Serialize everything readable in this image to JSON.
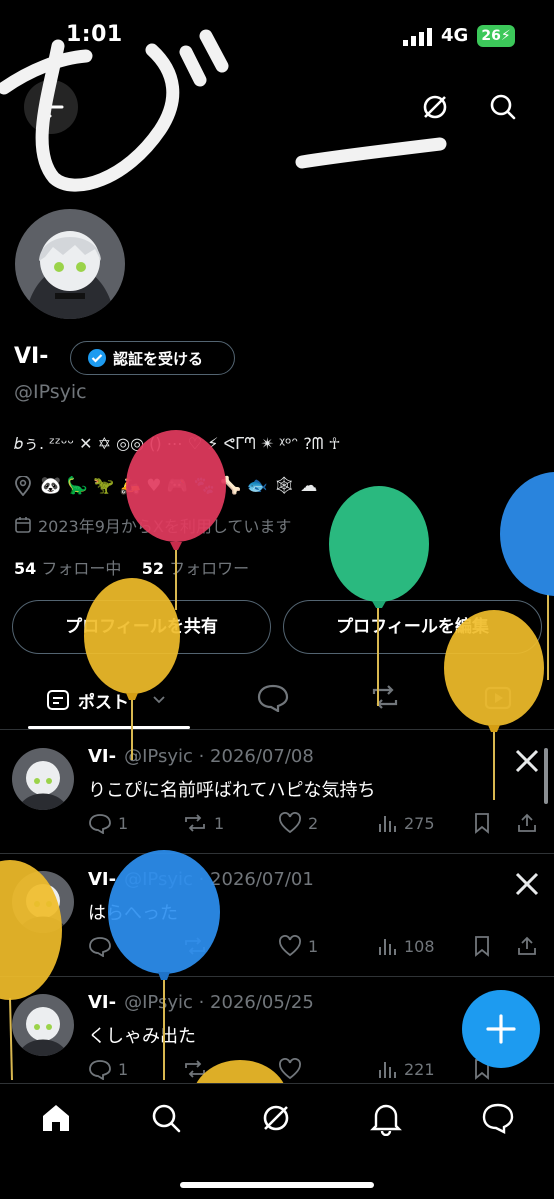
{
  "status_bar": {
    "time": "1:01",
    "network": "4G",
    "battery": "26"
  },
  "profile": {
    "display_name": "VI-",
    "verify_label": "認証を受ける",
    "handle": "@IPsyic",
    "bio": "𝑏ぅ. ᶻᶻᵕᵕ ✕ ✡ ◎◎ () ⋯ ♡ ⚡ ᕙᒥᘉ ✴ ᵡᵒᵔ ?ᗰ ☥",
    "location_emojis": "🐼 🦕 🦖 🛵 ♥ 🎮 🐾 🦴 🐟 🕸 ☁",
    "joined": "2023年9月からXを利用しています",
    "following_count": "54",
    "following_label": "フォロー中",
    "followers_count": "52",
    "followers_label": "フォロワー",
    "share_label": "プロフィールを共有",
    "edit_label": "プロフィールを編集"
  },
  "tabs": {
    "posts_label": "ポスト"
  },
  "posts": [
    {
      "name": "VI-",
      "handle_date": "@IPsyic · 2026/07/08",
      "text": "りこぴに名前呼ばれてハピな気持ち",
      "replies": "1",
      "reposts": "1",
      "likes": "2",
      "views": "275"
    },
    {
      "name": "VI-",
      "handle_date": "@IPsyic · 2026/07/01",
      "text": "はらへった",
      "replies": "",
      "reposts": "",
      "likes": "1",
      "views": "108"
    },
    {
      "name": "VI-",
      "handle_date": "@IPsyic · 2026/05/25",
      "text": "くしゃみ出た",
      "replies": "1",
      "reposts": "",
      "likes": "",
      "views": "221"
    }
  ],
  "overlay": {
    "handwriting": "びー"
  },
  "colors": {
    "accent": "#1d9bf0",
    "muted": "#71767b",
    "balloon_red": "#e33b5e",
    "balloon_green": "#2ec98a",
    "balloon_yellow": "#f0bd2a",
    "balloon_blue": "#2c8ff0"
  }
}
